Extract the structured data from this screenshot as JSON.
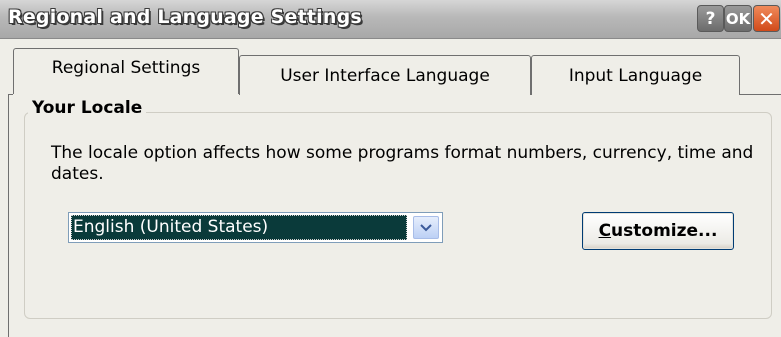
{
  "window": {
    "title": "Regional and Language Settings",
    "help_label": "?",
    "ok_label": "OK",
    "close_label": "✕"
  },
  "tabs": [
    {
      "label": "Regional Settings",
      "selected": true
    },
    {
      "label": "User Interface Language",
      "selected": false
    },
    {
      "label": "Input Language",
      "selected": false
    }
  ],
  "locale_group": {
    "legend": "Your Locale",
    "description": "The locale option affects how some programs format numbers, currency, time and dates.",
    "locale_value": "English (United States)",
    "customize_accel": "C",
    "customize_rest": "ustomize..."
  },
  "colors": {
    "titlebar": "#b8b8b8",
    "close_button": "#d14a1a",
    "selection": "#0a3a3a",
    "window_bg": "#efeee8"
  }
}
